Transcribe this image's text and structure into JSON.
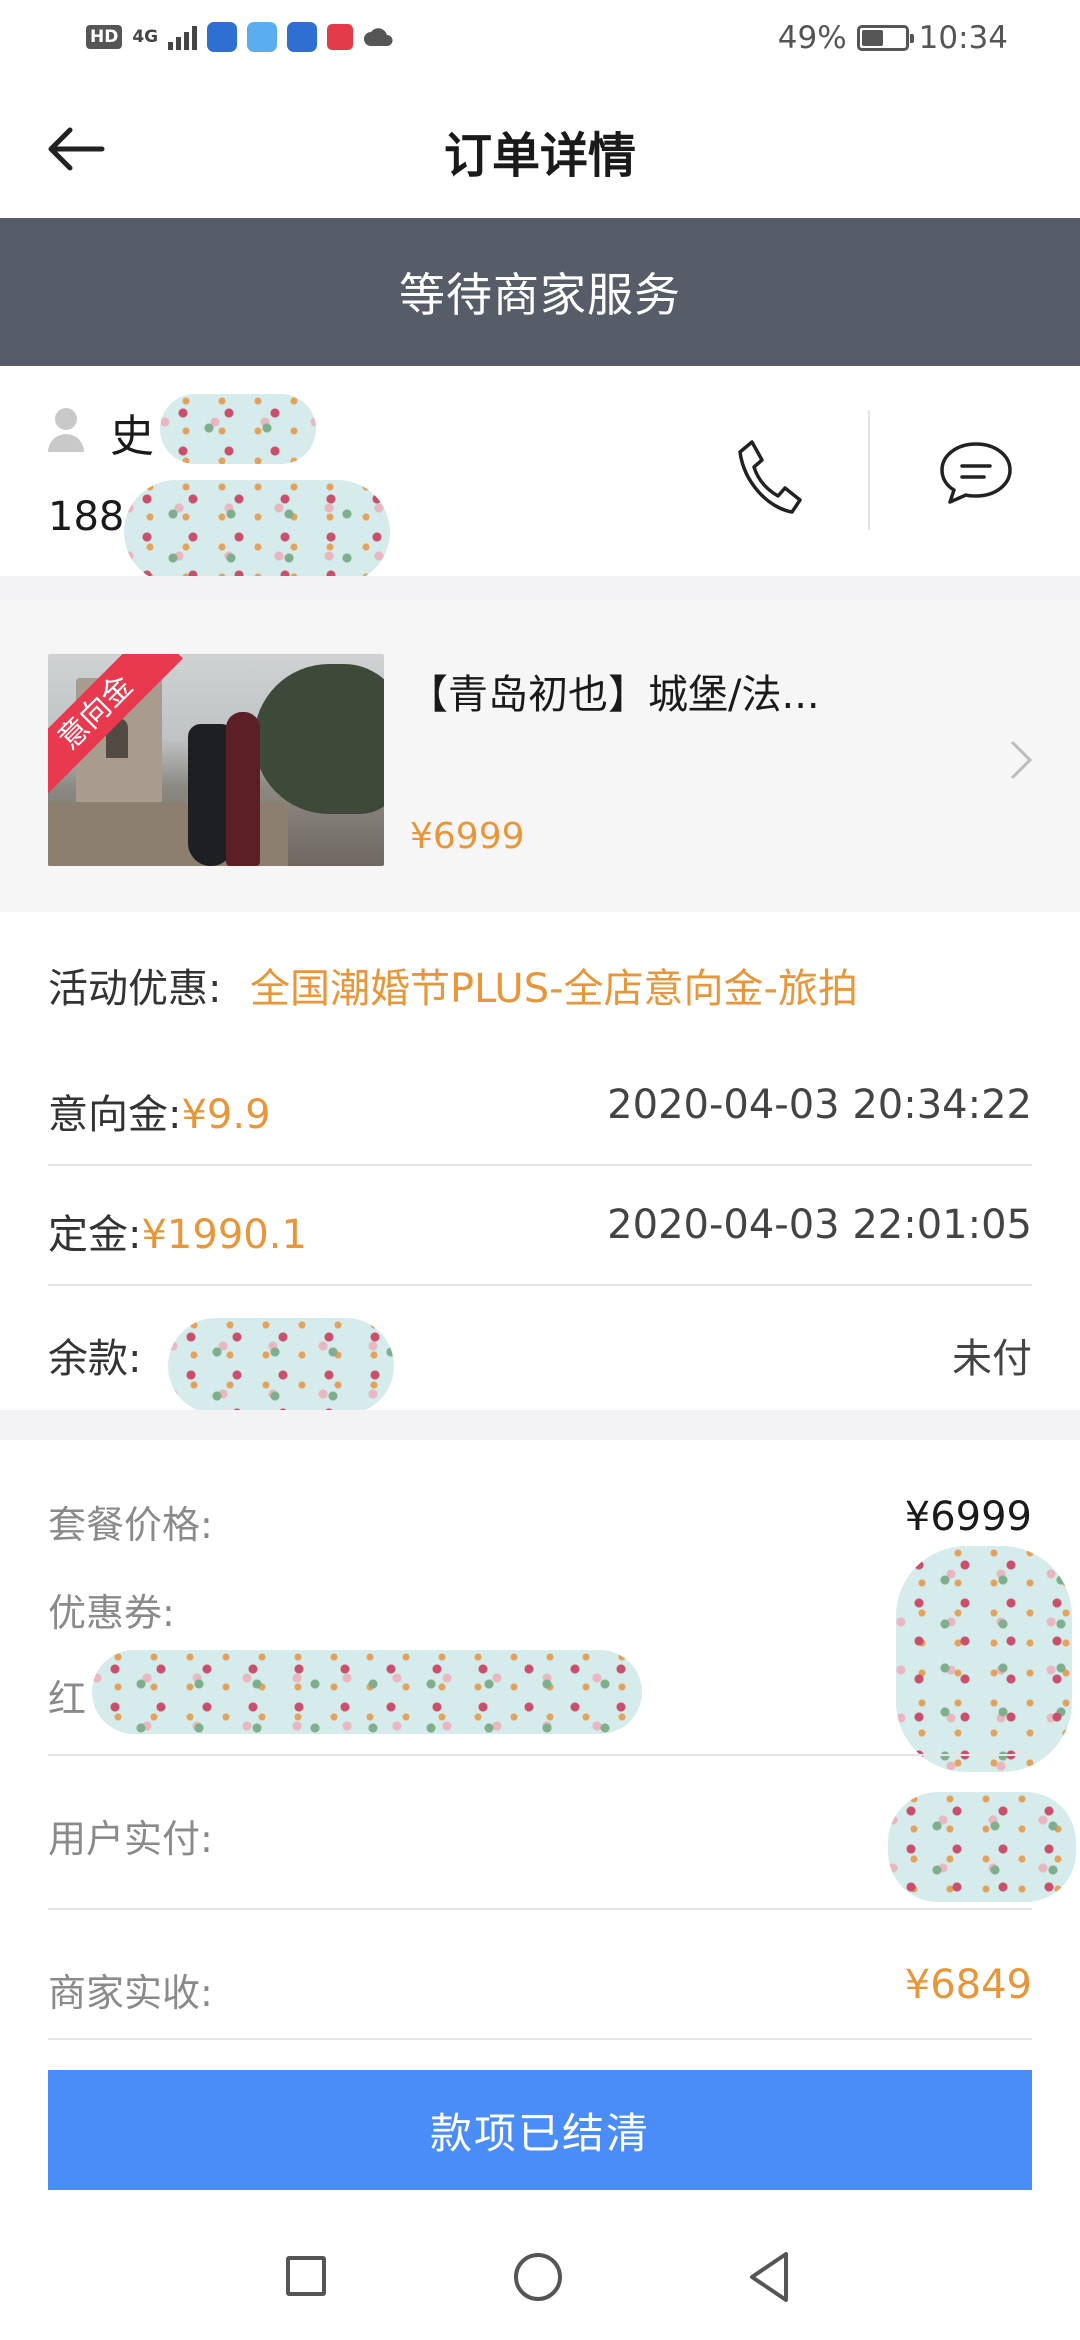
{
  "status_bar": {
    "hd": "HD",
    "network": "4G",
    "battery": "49%",
    "battery_level": 0.49,
    "time": "10:34"
  },
  "header": {
    "title": "订单详情"
  },
  "banner": {
    "text": "等待商家服务"
  },
  "customer": {
    "name": "史",
    "phone": "188"
  },
  "product": {
    "badge": "意向金",
    "name": "【青岛初也】城堡/法...",
    "price": "¥6999"
  },
  "promo": {
    "label": "活动优惠:",
    "value": "全国潮婚节PLUS-全店意向金-旅拍"
  },
  "payments": [
    {
      "label": "意向金:",
      "value": "¥9.9",
      "time": "2020-04-03 20:34:22"
    },
    {
      "label": "定金:",
      "value": "¥1990.1",
      "time": "2020-04-03 22:01:05"
    },
    {
      "label": "余款:",
      "value": "",
      "time": "未付"
    }
  ],
  "summary": {
    "package_label": "套餐价格:",
    "package_value": "¥6999",
    "coupon_label": "优惠券:",
    "red_label": "红",
    "paid_label": "用户实付:",
    "received_label": "商家实收:",
    "received_value": "¥6849"
  },
  "action": {
    "label": "款项已结清"
  },
  "colors": {
    "accent": "#e8963a",
    "banner": "#575d68",
    "button": "#4a8cf8",
    "badge": "#e8394e"
  }
}
